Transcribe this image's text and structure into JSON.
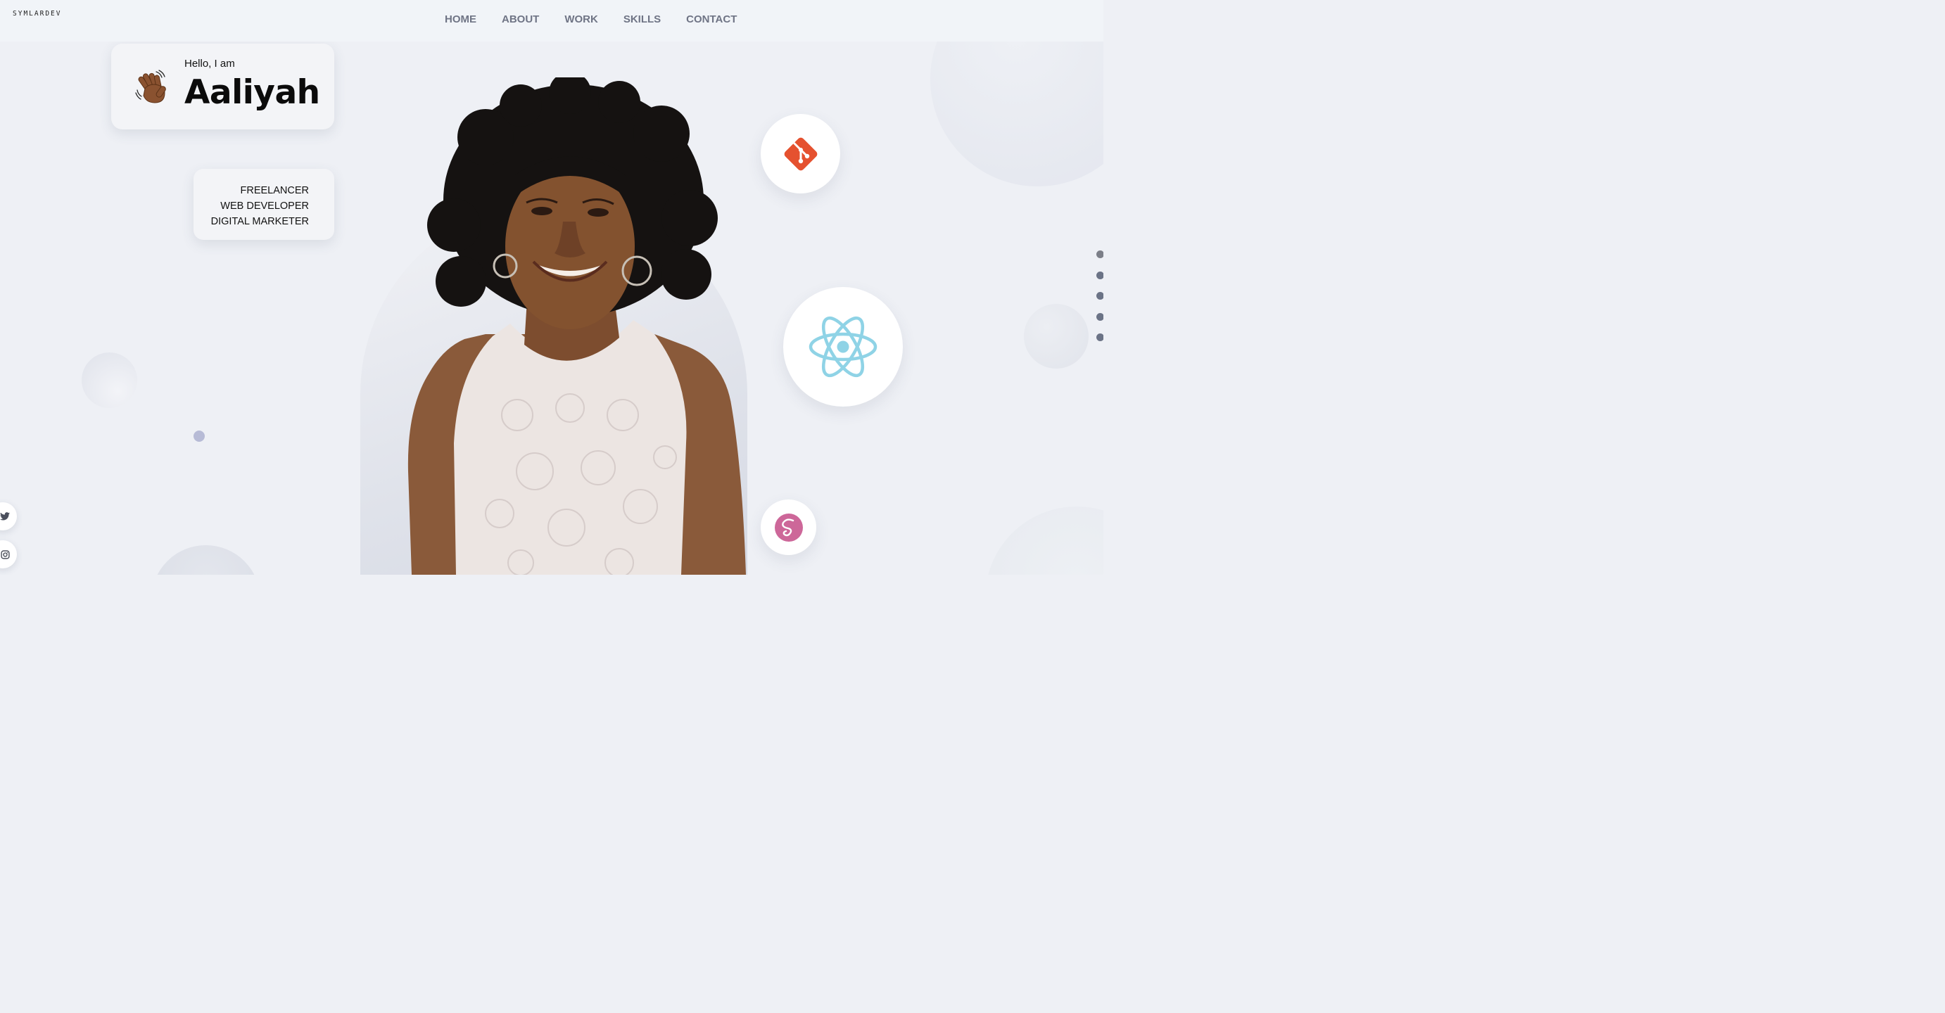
{
  "header": {
    "logo": "SYMLARDEV",
    "nav": [
      {
        "label": "HOME"
      },
      {
        "label": "ABOUT"
      },
      {
        "label": "WORK"
      },
      {
        "label": "SKILLS"
      },
      {
        "label": "CONTACT"
      }
    ]
  },
  "intro": {
    "greeting": "Hello, I am",
    "name": "Aaliyah",
    "wave_icon": "waving-hand-icon"
  },
  "roles": [
    "FREELANCER",
    "WEB DEVELOPER",
    "DIGITAL MARKETER"
  ],
  "tech_icons": [
    "git-icon",
    "react-icon",
    "sass-icon"
  ],
  "section_dots": {
    "count": 5,
    "active_index": 0
  },
  "social": [
    "twitter-icon",
    "instagram-icon"
  ],
  "colors": {
    "background": "#eef0f5",
    "nav_text": "#6f7485",
    "git": "#e5512f",
    "react": "#8fd3e6",
    "sass": "#cd6799"
  }
}
